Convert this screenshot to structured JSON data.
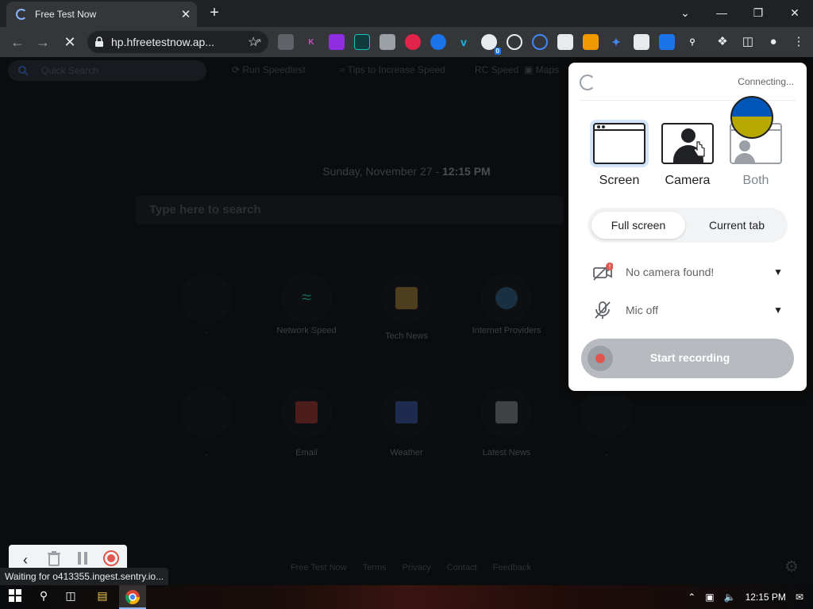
{
  "browser": {
    "tab_title": "Free Test Now",
    "tab_close": "✕",
    "new_tab": "+",
    "url": "hp.hfreetestnow.ap...",
    "ext_badge": "0"
  },
  "page": {
    "search_placeholder": "Quick Search",
    "links": [
      "Run Speedtest",
      "Tips to Increase Speed",
      "Speed",
      "Maps"
    ],
    "date": "Sunday, November 27 - ",
    "time": "12:15 PM",
    "main_search_placeholder": "Type here to search",
    "tiles": [
      {
        "label": ".",
        "icon_color": "#2a2c30"
      },
      {
        "label": "Network Speed",
        "icon_color": "#1bb5a0"
      },
      {
        "label": "Tech News",
        "icon_color": "#c59a3a"
      },
      {
        "label": "Internet Providers",
        "icon_color": "#2a6f9a"
      },
      {
        "label": ".",
        "icon_color": "#2a2c30"
      },
      {
        "label": "Email",
        "icon_color": "#c0392b"
      },
      {
        "label": "Weather",
        "icon_color": "#3b5ec0"
      },
      {
        "label": "Latest News",
        "icon_color": "#9aa0a6"
      },
      {
        "label": ".",
        "icon_color": "#2a2c30"
      }
    ],
    "footer": [
      "Free Test Now",
      "Terms",
      "Privacy",
      "Contact",
      "Feedback"
    ]
  },
  "status_bar": "Waiting for o413355.ingest.sentry.io...",
  "recorder": {
    "connecting": "Connecting...",
    "modes": [
      "Screen",
      "Camera",
      "Both"
    ],
    "scope_selected": "Full screen",
    "scope_other": "Current tab",
    "camera": "No camera found!",
    "mic": "Mic off",
    "start": "Start recording"
  },
  "taskbar": {
    "clock": "12:15 PM"
  },
  "colors": {
    "accent": "#8ab4f8",
    "record_red": "#e0574f",
    "flag_blue": "#0057b7",
    "flag_yellow": "#b8a900"
  }
}
